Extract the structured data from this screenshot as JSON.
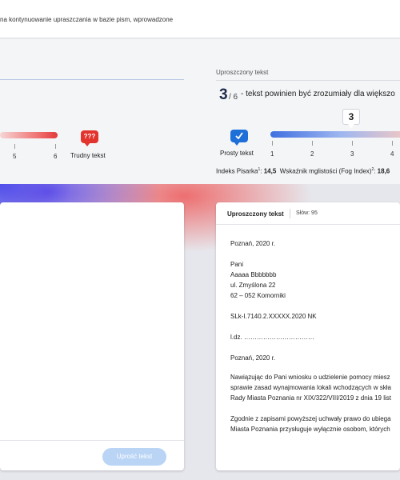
{
  "top_bar": {
    "text": "na kontynuowanie upraszczania w bazie pism, wprowadzone"
  },
  "left_scale": {
    "ticks": [
      "5",
      "6"
    ],
    "difficult_icon_text": "???",
    "difficult_label": "Trudny tekst"
  },
  "right_panel": {
    "title": "Uproszczony tekst",
    "score": "3",
    "score_denominator": "/ 6",
    "score_desc": "- tekst powinien być zrozumiały dla większo",
    "simple_label": "Prosty tekst",
    "ticks": [
      "1",
      "2",
      "3",
      "4"
    ],
    "slider_value": "3",
    "slider_level": 3,
    "pisarek_label": "Indeks Pisarka",
    "pisarek_sup": "1",
    "pisarek_value": "14,5",
    "fog_label": "Wskaźnik mglistości (Fog Index)",
    "fog_sup": "2",
    "fog_value": "18,6"
  },
  "left_card": {
    "button_label": "Uprość tekst"
  },
  "right_card": {
    "title": "Uproszczony tekst",
    "word_count_label": "Słów: 95",
    "lines": [
      "Poznań, 2020 r.",
      "Pani",
      "Aaaaa Bbbbbbb",
      "ul. Zmyślona 22",
      "62 – 052 Komorniki",
      "SLk-I.7140.2.XXXXX.2020 NK",
      "l.dz. ……………………………",
      "Poznań, 2020 r.",
      "Nawiązując do Pani wniosku o udzielenie pomocy miesz",
      "sprawie zasad wynajmowania lokali wchodzących w skła",
      "Rady Miasta Poznania nr XIX/322/VIII/2019 z dnia 19 list",
      "Zgodnie z zapisami powyższej uchwały prawo do ubiega",
      "Miasta Poznania przysługuje wyłącznie osobom, których"
    ]
  },
  "colors": {
    "accent_blue": "#1f6fd8",
    "accent_red": "#e2342d"
  }
}
